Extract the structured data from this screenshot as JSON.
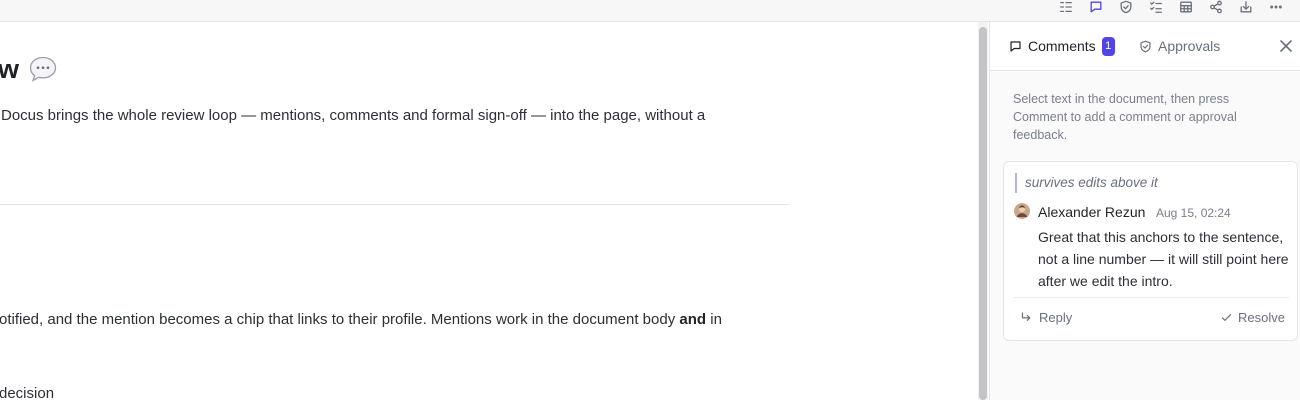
{
  "toolbar": {
    "icons": [
      "outline-icon",
      "comment-icon",
      "approval-shield-icon",
      "checklist-icon",
      "table-icon",
      "share-icon",
      "download-icon",
      "more-icon"
    ],
    "active_icon": "comment-icon",
    "accent_color": "#4f46e5"
  },
  "document": {
    "title": "w",
    "title_emoji": "speech-bubble-emoji",
    "paragraph_1": "Docus brings the whole review loop — mentions, comments and formal sign-off — into the page, without a",
    "paragraph_2_start": "otified, and the mention becomes a chip that links to their profile. Mentions work in the document body ",
    "paragraph_2_bold": "and",
    "paragraph_2_end": " in",
    "paragraph_3": "decision"
  },
  "panel": {
    "tabs": {
      "comments_label": "Comments",
      "comments_count": "1",
      "approvals_label": "Approvals"
    },
    "hint": "Select text in the document, then press Comment to add a comment or approval feedback.",
    "comment": {
      "quote": "survives edits above it",
      "author": "Alexander Rezun",
      "timestamp": "Aug 15, 02:24",
      "body": "Great that this anchors to the sentence, not a line number — it will still point here after we edit the intro.",
      "reply_label": "Reply",
      "resolve_label": "Resolve"
    }
  }
}
